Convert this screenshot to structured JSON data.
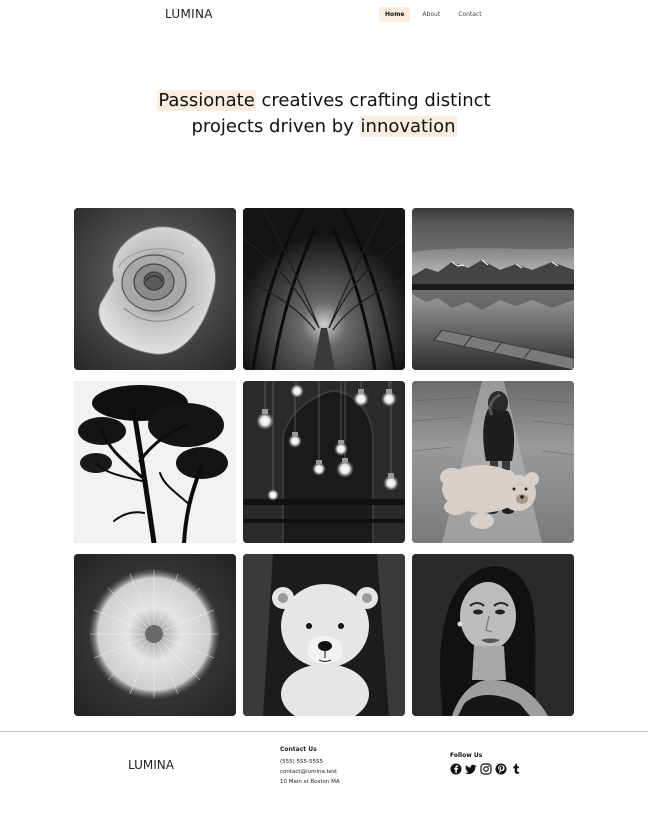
{
  "header": {
    "logo": "LUMINA",
    "nav": [
      {
        "label": "Home",
        "active": true
      },
      {
        "label": "About",
        "active": false
      },
      {
        "label": "Contact",
        "active": false
      }
    ]
  },
  "hero": {
    "part1_hl": "Passionate",
    "part2": " creatives crafting distinct",
    "part3": "projects driven by ",
    "part4_hl": "innovation"
  },
  "gallery": [
    {
      "subject": "rose"
    },
    {
      "subject": "forest tunnel"
    },
    {
      "subject": "mountain lake with pier"
    },
    {
      "subject": "tree silhouettes"
    },
    {
      "subject": "hanging light bulbs"
    },
    {
      "subject": "girl with teddy bear"
    },
    {
      "subject": "dandelion"
    },
    {
      "subject": "polar bear cub"
    },
    {
      "subject": "woman portrait"
    }
  ],
  "footer": {
    "logo": "LUMINA",
    "contact_title": "Contact Us",
    "phone": "(555) 555-5555",
    "email": "contact@lumina.test",
    "address": "10 Main st Boston MA",
    "follow_title": "Follow Us",
    "socials": [
      "facebook-icon",
      "twitter-icon",
      "instagram-icon",
      "pinterest-icon",
      "tumblr-icon"
    ]
  },
  "colors": {
    "highlight": "#fbeee0",
    "active_nav_bg": "#fbeee0",
    "footer_border": "#bfbfbf"
  }
}
